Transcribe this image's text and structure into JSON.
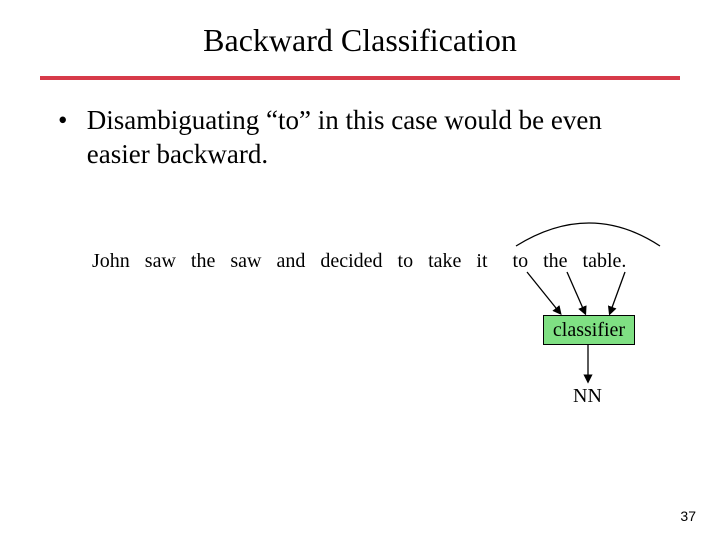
{
  "title": "Backward Classification",
  "bullet_text": "Disambiguating “to” in this case would be even easier backward.",
  "sentence": {
    "words": [
      "John",
      "saw",
      "the",
      "saw",
      "and",
      "decided",
      "to",
      "take",
      "it",
      "to",
      "the",
      "table."
    ]
  },
  "classifier_label": "classifier",
  "output_label": "NN",
  "page_number": "37",
  "colors": {
    "rule": "#d73a49",
    "classifier_fill": "#7fe083"
  }
}
